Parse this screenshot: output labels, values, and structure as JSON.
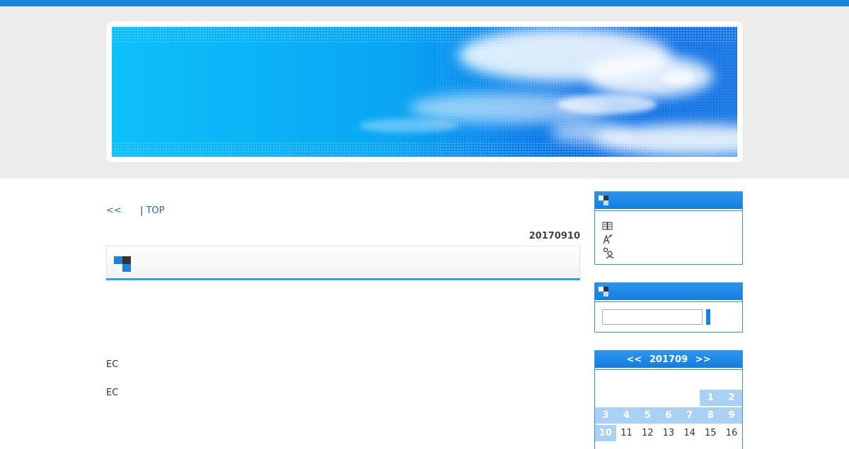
{
  "nav": {
    "prev_label": "<<",
    "separator": "|",
    "top_label": "TOP"
  },
  "entry": {
    "date": "20170910",
    "title": ""
  },
  "body_lines": [
    "EC",
    "EC"
  ],
  "sidebar": {
    "links_icons": [
      "book-icon",
      "pen-tool-icon",
      "user-gear-icon"
    ],
    "search": {
      "value": "",
      "placeholder": ""
    }
  },
  "calendar": {
    "prev": "<<",
    "month": "201709",
    "next": ">>",
    "weeks": [
      [
        "",
        "",
        "",
        "",
        "",
        "1",
        "2"
      ],
      [
        "3",
        "4",
        "5",
        "6",
        "7",
        "8",
        "9"
      ],
      [
        "10",
        "11",
        "12",
        "13",
        "14",
        "15",
        "16"
      ]
    ],
    "today": "10"
  },
  "colors": {
    "accent": "#1a83e0",
    "header_bg": "#ececec",
    "title_rule": "#29a3e3",
    "cal_past": "#a9d1f4"
  }
}
